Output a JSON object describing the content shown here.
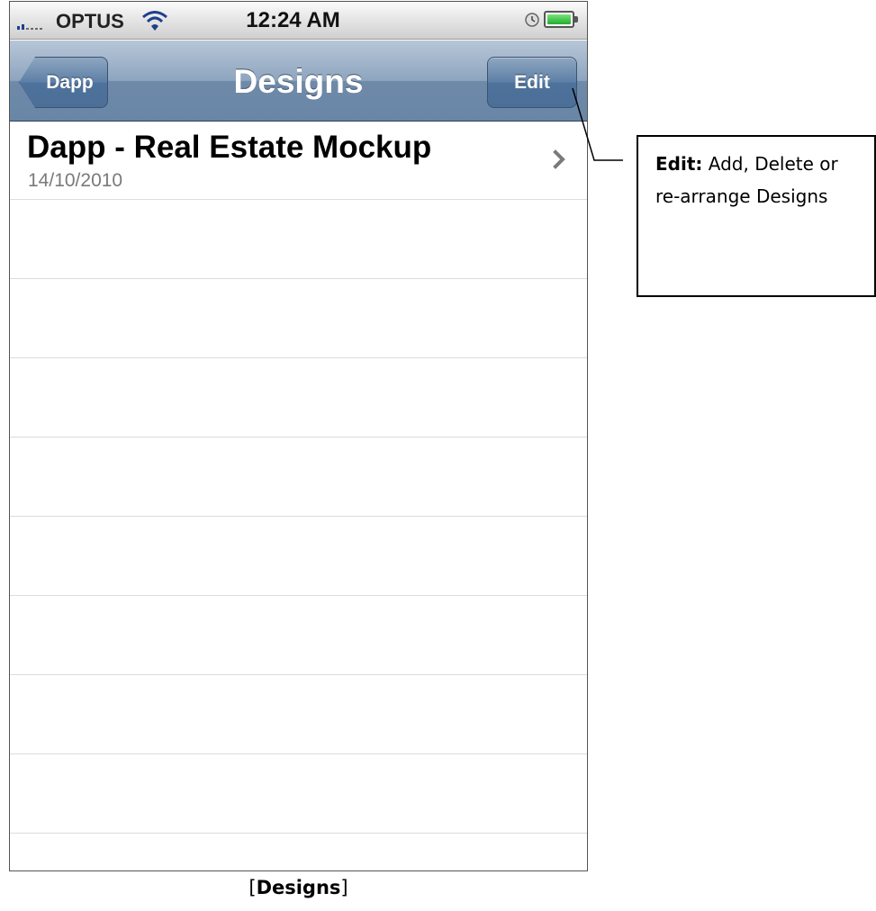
{
  "status_bar": {
    "carrier": "OPTUS",
    "time": "12:24 AM",
    "icons": [
      "signal-icon",
      "wifi-icon",
      "alarm-icon",
      "battery-icon"
    ]
  },
  "nav_bar": {
    "title": "Designs",
    "back_label": "Dapp",
    "edit_label": "Edit"
  },
  "designs": [
    {
      "title": "Dapp - Real Estate Mockup",
      "date": "14/10/2010"
    }
  ],
  "callout": {
    "bold": "Edit:",
    "text": " Add, Delete or re-arrange Designs"
  },
  "caption": {
    "open": "[",
    "bold": "Designs",
    "close": "]"
  },
  "colors": {
    "nav_bar": "#7f98b5",
    "button": "#5a7ca3",
    "subtitle": "#7a7a7a",
    "separator": "#dcdcdc"
  }
}
